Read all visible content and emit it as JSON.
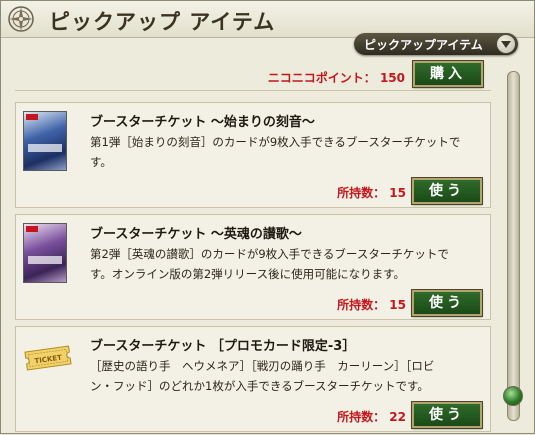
{
  "header": {
    "title": "ピックアップ アイテム"
  },
  "dropdown": {
    "selected": "ピックアップアイテム"
  },
  "points_row": {
    "text": "ニコニコポイント： 150",
    "button": "購入"
  },
  "items": [
    {
      "title": "ブースターチケット ～始まりの刻音～",
      "desc_line1": "第1弾［始まりの刻音］のカードが9枚入手できるブースターチケットで",
      "desc_line2": "す。",
      "owned": "所持数： 15",
      "button": "使う"
    },
    {
      "title": "ブースターチケット ～英魂の讃歌～",
      "desc_line1": "第2弾［英魂の讃歌］のカードが9枚入手できるブースターチケットで",
      "desc_line2": "す。オンライン版の第2弾リリース後に使用可能になります。",
      "owned": "所持数： 15",
      "button": "使う"
    },
    {
      "title": "ブースターチケット ［プロモカード限定-3］",
      "desc_line1": "［歴史の語り手　ヘウメネア］［戦刃の踊り手　カーリーン］［ロビ",
      "desc_line2": "ン・フッド］のどれか1枚が入手できるブースターチケットです。",
      "owned": "所持数： 22",
      "button": "使う",
      "ticket_label": "TICKET"
    }
  ],
  "colors": {
    "accent_red": "#c4161c",
    "button_green": "#1b4a18"
  }
}
